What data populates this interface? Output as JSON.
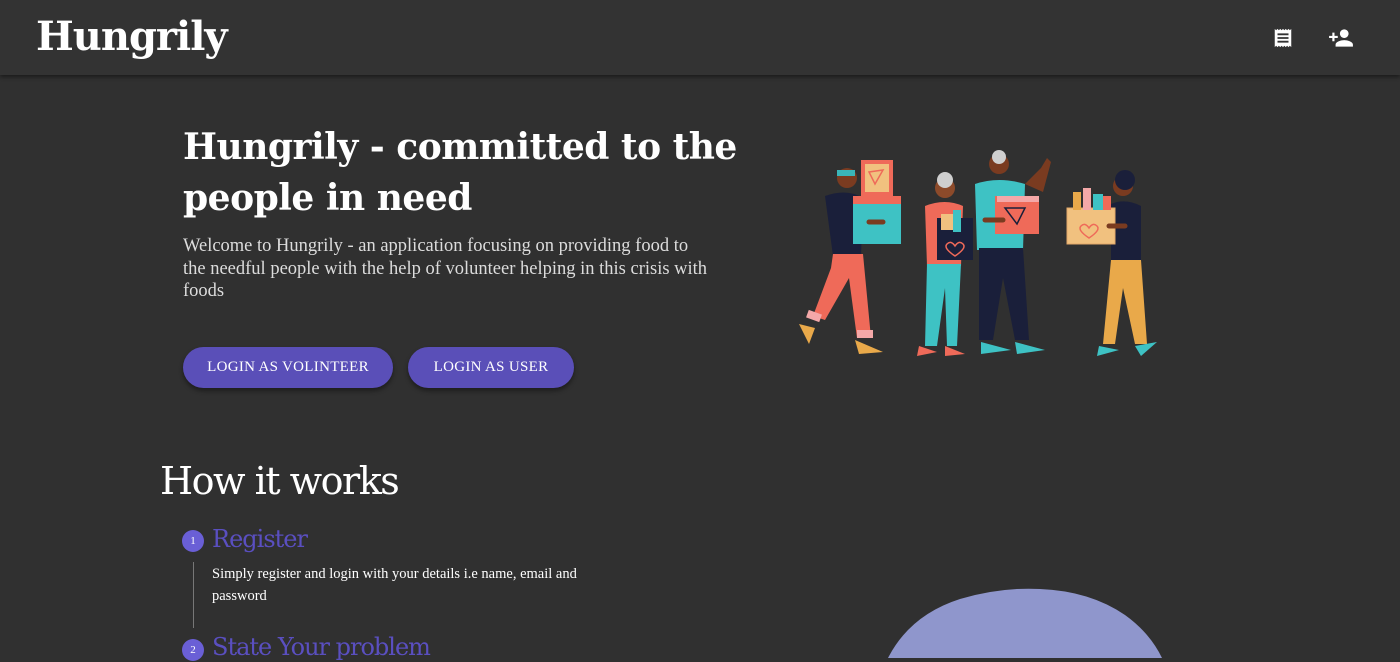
{
  "app": {
    "brand": "Hungrily"
  },
  "header": {
    "icons": [
      "receipt-icon",
      "person-add-icon"
    ]
  },
  "hero": {
    "title": "Hungrily - committed to the people in need",
    "description": "Welcome to Hungrily - an application focusing on providing food to the needful people with the help of volunteer helping in this crisis with foods",
    "buttons": {
      "volunteer": "LOGIN AS VOLINTEER",
      "user": "LOGIN AS USER"
    }
  },
  "how_it_works": {
    "title": "How it works",
    "steps": [
      {
        "number": "1",
        "title": "Register",
        "description": "Simply register and login with your details i.e name, email and password"
      },
      {
        "number": "2",
        "title": "State Your problem"
      }
    ]
  },
  "colors": {
    "background": "#303030",
    "appbar": "#333333",
    "accent": "#5a4fb8",
    "step_title": "#5a4fc0"
  }
}
